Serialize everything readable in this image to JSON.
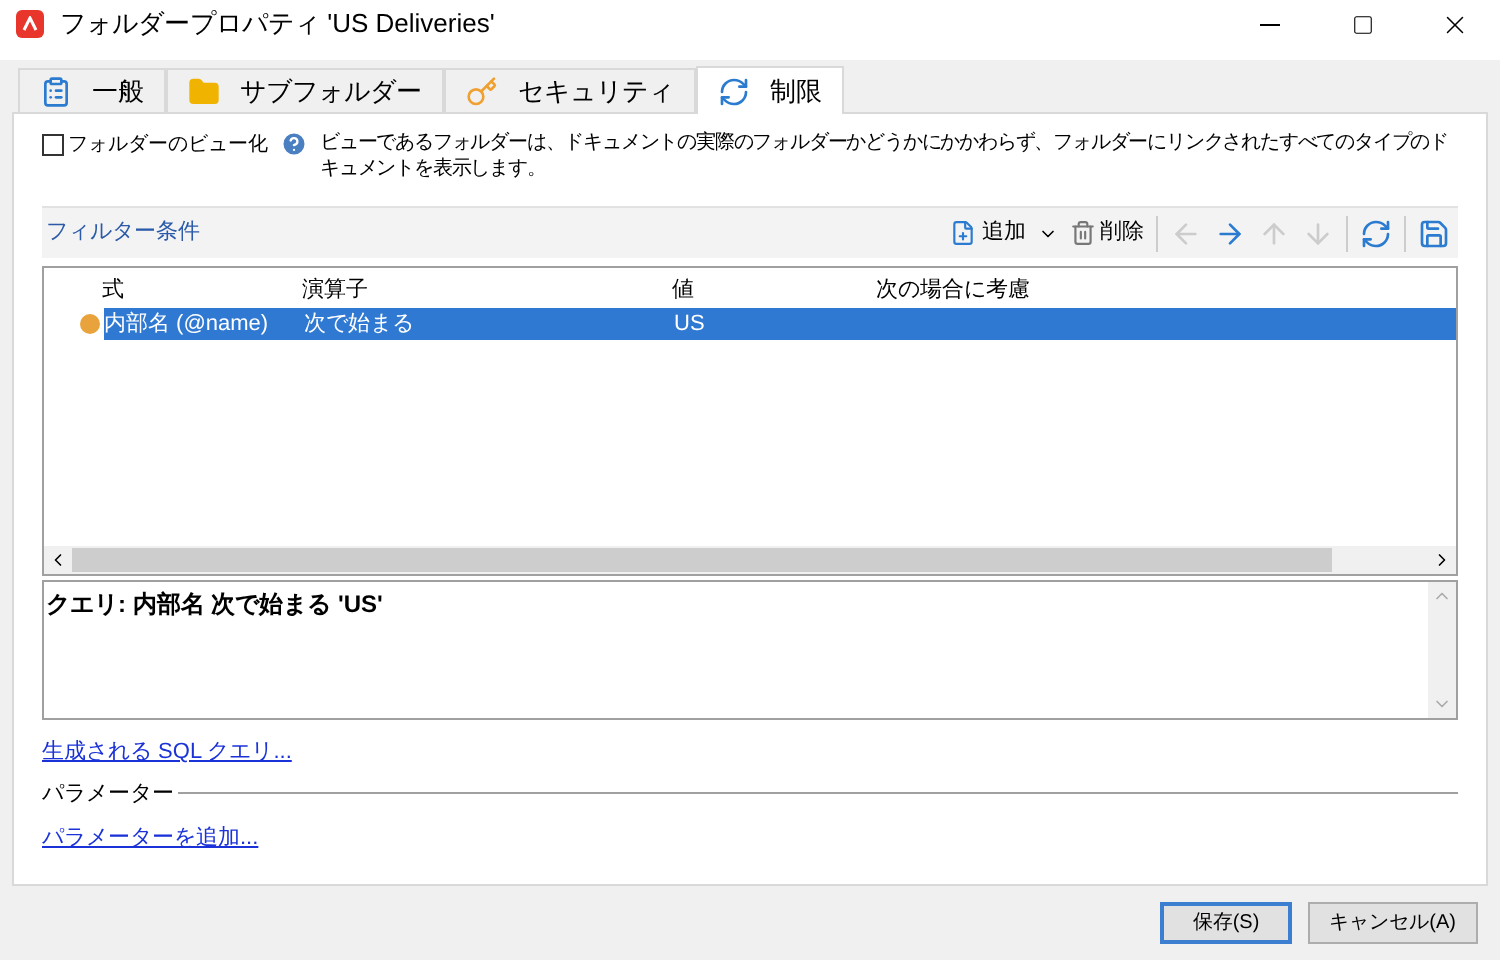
{
  "window": {
    "title": "フォルダープロパティ 'US Deliveries'"
  },
  "tabs": [
    {
      "label": "一般",
      "selected": false
    },
    {
      "label": "サブフォルダー",
      "selected": false
    },
    {
      "label": "セキュリティ",
      "selected": false
    },
    {
      "label": "制限",
      "selected": true
    }
  ],
  "view_option": {
    "label": "フォルダーのビュー化",
    "checked": false,
    "help": "ビューであるフォルダーは、ドキュメントの実際のフォルダーかどうかにかかわらず、フォルダーにリンクされたすべてのタイプのドキュメントを表示します。"
  },
  "filter": {
    "title": "フィルター条件",
    "add": "追加",
    "delete": "削除",
    "columns": [
      "式",
      "演算子",
      "値",
      "次の場合に考慮"
    ],
    "rows": [
      {
        "selected": true,
        "color": "#e8a33c",
        "cells": [
          "内部名 (@name)",
          "次で始まる",
          "US",
          ""
        ]
      }
    ]
  },
  "query": "クエリ: 内部名 次で始まる 'US'",
  "sql_link": "生成される SQL クエリ...",
  "parameters": {
    "title": "パラメーター",
    "add_link": "パラメーターを追加..."
  },
  "buttons": [
    {
      "label": "保存(S)",
      "default": true
    },
    {
      "label": "キャンセル(A)",
      "default": false
    }
  ]
}
